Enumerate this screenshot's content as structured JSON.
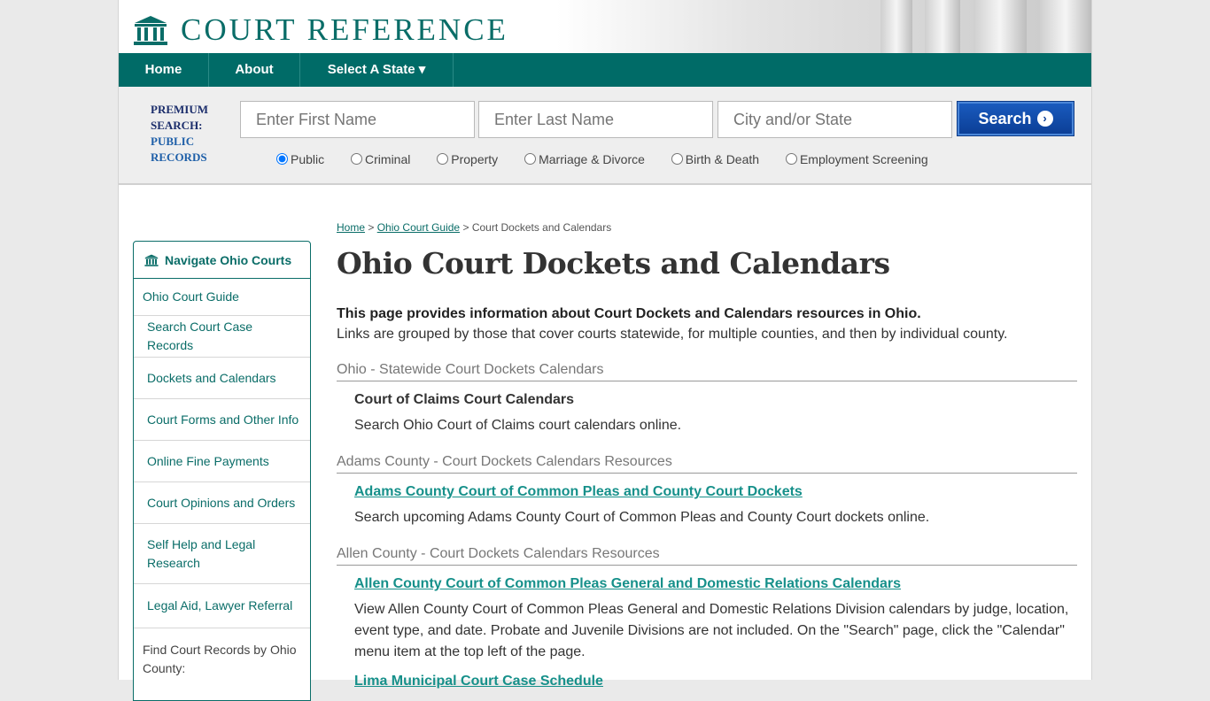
{
  "site": {
    "logo_text": "COURT REFERENCE"
  },
  "nav": {
    "items": [
      {
        "label": "Home"
      },
      {
        "label": "About"
      },
      {
        "label": "Select A State ▾"
      }
    ]
  },
  "search": {
    "premium_line1": "PREMIUM",
    "premium_line2": "SEARCH:",
    "premium_line3": "PUBLIC",
    "premium_line4": "RECORDS",
    "first_placeholder": "Enter First Name",
    "last_placeholder": "Enter Last Name",
    "city_placeholder": "City and/or State",
    "button_label": "Search",
    "options": [
      "Public",
      "Criminal",
      "Property",
      "Marriage & Divorce",
      "Birth & Death",
      "Employment Screening"
    ],
    "selected": "Public"
  },
  "sidebar": {
    "title": "Navigate Ohio Courts",
    "items": [
      "Ohio Court Guide",
      "Search Court Case Records",
      "Dockets and Calendars",
      "Court Forms and Other Info",
      "Online Fine Payments",
      "Court Opinions and Orders",
      "Self Help and Legal Research",
      "Legal Aid, Lawyer Referral"
    ],
    "county_label": "Find Court Records by Ohio County:"
  },
  "breadcrumb": {
    "home": "Home",
    "guide": "Ohio Court Guide",
    "current": "Court Dockets and Calendars",
    "sep": ">"
  },
  "page": {
    "title": "Ohio Court Dockets and Calendars",
    "intro_bold": "This page provides information about Court Dockets and Calendars resources in Ohio.",
    "intro_text": "Links are grouped by those that cover courts statewide, for multiple counties, and then by individual county."
  },
  "sections": [
    {
      "heading": "Ohio - Statewide Court Dockets Calendars",
      "entries": [
        {
          "title": "Court of Claims Court Calendars",
          "desc": "Search Ohio Court of Claims court calendars online."
        }
      ]
    },
    {
      "heading": "Adams County - Court Dockets Calendars Resources",
      "entries": [
        {
          "title": "Adams County Court of Common Pleas and County Court Dockets",
          "desc": "Search upcoming Adams County Court of Common Pleas and County Court dockets online."
        }
      ]
    },
    {
      "heading": "Allen County - Court Dockets Calendars Resources",
      "entries": [
        {
          "title": "Allen County Court of Common Pleas General and Domestic Relations Calendars",
          "desc": "View Allen County Court of Common Pleas General and Domestic Relations Division calendars by judge, location, event type, and date. Probate and Juvenile Divisions are not included. On the \"Search\" page, click the \"Calendar\" menu item at the top left of the page."
        },
        {
          "title": "Lima Municipal Court Case Schedule",
          "desc": ""
        }
      ]
    }
  ],
  "colors": {
    "brand_teal": "#006b67",
    "link": "#16908a",
    "search_blue": "#0b3d94"
  },
  "icons": {
    "logo": "courthouse-icon",
    "sidebar": "courthouse-icon",
    "button": "chevron-right-icon"
  }
}
